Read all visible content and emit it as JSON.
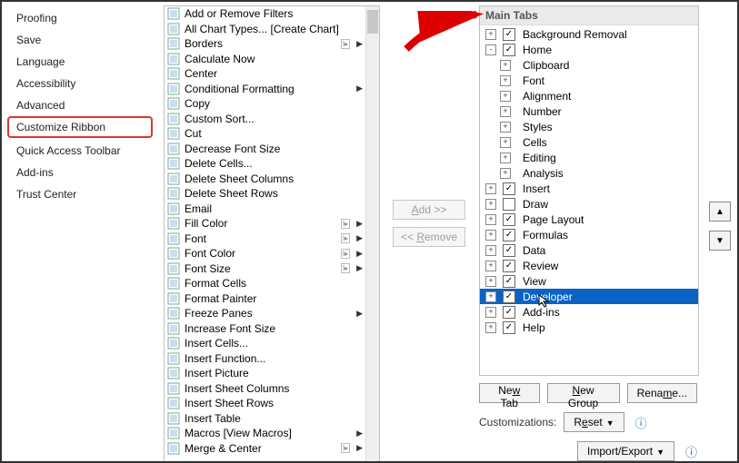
{
  "sidebar": {
    "items": [
      {
        "label": "Proofing"
      },
      {
        "label": "Save"
      },
      {
        "label": "Language"
      },
      {
        "label": "Accessibility"
      },
      {
        "label": "Advanced"
      },
      {
        "label": "Customize Ribbon"
      },
      {
        "label": "Quick Access Toolbar"
      },
      {
        "label": "Add-ins"
      },
      {
        "label": "Trust Center"
      }
    ]
  },
  "commands": [
    {
      "label": "Add or Remove Filters",
      "arrow": false
    },
    {
      "label": "All Chart Types... [Create Chart]",
      "arrow": false
    },
    {
      "label": "Borders",
      "arrow": true,
      "mini": true
    },
    {
      "label": "Calculate Now",
      "arrow": false
    },
    {
      "label": "Center",
      "arrow": false
    },
    {
      "label": "Conditional Formatting",
      "arrow": true
    },
    {
      "label": "Copy",
      "arrow": false
    },
    {
      "label": "Custom Sort...",
      "arrow": false
    },
    {
      "label": "Cut",
      "arrow": false
    },
    {
      "label": "Decrease Font Size",
      "arrow": false
    },
    {
      "label": "Delete Cells...",
      "arrow": false
    },
    {
      "label": "Delete Sheet Columns",
      "arrow": false
    },
    {
      "label": "Delete Sheet Rows",
      "arrow": false
    },
    {
      "label": "Email",
      "arrow": false
    },
    {
      "label": "Fill Color",
      "arrow": true,
      "mini": true
    },
    {
      "label": "Font",
      "arrow": true,
      "mini": true
    },
    {
      "label": "Font Color",
      "arrow": true,
      "mini": true
    },
    {
      "label": "Font Size",
      "arrow": true,
      "mini": true
    },
    {
      "label": "Format Cells",
      "arrow": false
    },
    {
      "label": "Format Painter",
      "arrow": false
    },
    {
      "label": "Freeze Panes",
      "arrow": true
    },
    {
      "label": "Increase Font Size",
      "arrow": false
    },
    {
      "label": "Insert Cells...",
      "arrow": false
    },
    {
      "label": "Insert Function...",
      "arrow": false
    },
    {
      "label": "Insert Picture",
      "arrow": false
    },
    {
      "label": "Insert Sheet Columns",
      "arrow": false
    },
    {
      "label": "Insert Sheet Rows",
      "arrow": false
    },
    {
      "label": "Insert Table",
      "arrow": false
    },
    {
      "label": "Macros [View Macros]",
      "arrow": true
    },
    {
      "label": "Merge & Center",
      "arrow": true,
      "mini": true
    }
  ],
  "mid": {
    "add": "Add >>",
    "remove": "<< Remove"
  },
  "tree": {
    "header": "Main Tabs",
    "items": [
      {
        "depth": 0,
        "exp": "+",
        "cb": true,
        "label": "Background Removal"
      },
      {
        "depth": 0,
        "exp": "-",
        "cb": true,
        "label": "Home"
      },
      {
        "depth": 1,
        "exp": "+",
        "label": "Clipboard"
      },
      {
        "depth": 1,
        "exp": "+",
        "label": "Font"
      },
      {
        "depth": 1,
        "exp": "+",
        "label": "Alignment"
      },
      {
        "depth": 1,
        "exp": "+",
        "label": "Number"
      },
      {
        "depth": 1,
        "exp": "+",
        "label": "Styles"
      },
      {
        "depth": 1,
        "exp": "+",
        "label": "Cells"
      },
      {
        "depth": 1,
        "exp": "+",
        "label": "Editing"
      },
      {
        "depth": 1,
        "exp": "+",
        "label": "Analysis"
      },
      {
        "depth": 0,
        "exp": "+",
        "cb": true,
        "label": "Insert"
      },
      {
        "depth": 0,
        "exp": "+",
        "cb": false,
        "label": "Draw"
      },
      {
        "depth": 0,
        "exp": "+",
        "cb": true,
        "label": "Page Layout"
      },
      {
        "depth": 0,
        "exp": "+",
        "cb": true,
        "label": "Formulas"
      },
      {
        "depth": 0,
        "exp": "+",
        "cb": true,
        "label": "Data"
      },
      {
        "depth": 0,
        "exp": "+",
        "cb": true,
        "label": "Review"
      },
      {
        "depth": 0,
        "exp": "+",
        "cb": true,
        "label": "View"
      },
      {
        "depth": 0,
        "exp": "+",
        "cb": true,
        "label": "Developer",
        "sel": true,
        "cursor": true
      },
      {
        "depth": 0,
        "exp": "+",
        "cb": true,
        "label": "Add-ins",
        "cursorOver": true
      },
      {
        "depth": 0,
        "exp": "+",
        "cb": true,
        "label": "Help"
      }
    ]
  },
  "updown": {
    "up": "▲",
    "down": "▼"
  },
  "bottom": {
    "newtab": "New Tab",
    "newgroup": "New Group",
    "rename": "Rename...",
    "cust_lbl": "Customizations:",
    "reset": "Reset",
    "import": "Import/Export"
  }
}
